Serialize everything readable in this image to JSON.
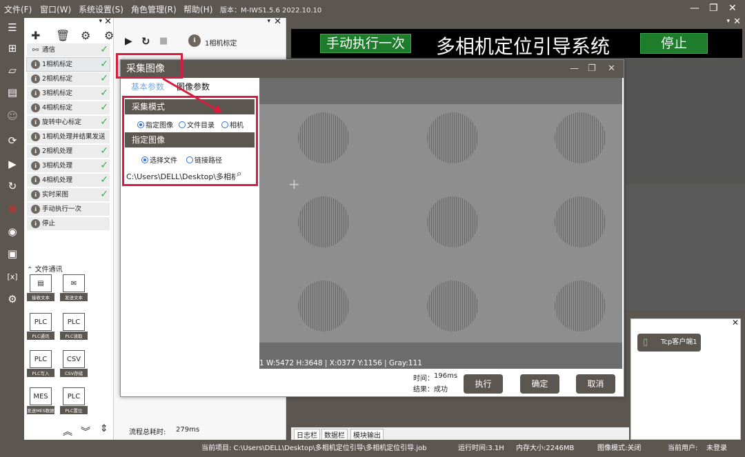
{
  "menu": {
    "file": "文件(F)",
    "window": "窗口(W)",
    "system_settings": "系统设置(S)",
    "role_management": "角色管理(R)",
    "help": "帮助(H)",
    "version": "版本：M-IWS1.5.6 2022.10.10"
  },
  "tree": {
    "items": [
      {
        "label": "通信",
        "checked": true,
        "icon": "network-icon"
      },
      {
        "label": "1相机标定",
        "checked": true,
        "selected": true
      },
      {
        "label": "2相机标定",
        "checked": true
      },
      {
        "label": "3相机标定",
        "checked": true
      },
      {
        "label": "4相机标定",
        "checked": true
      },
      {
        "label": "旋转中心标定",
        "checked": true
      },
      {
        "label": "1相机处理并结果发送",
        "checked": false
      },
      {
        "label": "2相机处理",
        "checked": true
      },
      {
        "label": "3相机处理",
        "checked": true
      },
      {
        "label": "4相机处理",
        "checked": true
      },
      {
        "label": "实时采图",
        "checked": true
      },
      {
        "label": "手动执行一次",
        "checked": false
      },
      {
        "label": "停止",
        "checked": false
      }
    ],
    "file_comm_header": "文件通讯",
    "tools": [
      {
        "label": "接收文本",
        "icon": "printer-icon"
      },
      {
        "label": "发送文本",
        "icon": "envelope-icon"
      },
      {
        "label": "PLC通讯",
        "icon": "plc-icon"
      },
      {
        "label": "PLC读取",
        "icon": "plc-icon"
      },
      {
        "label": "PLC写入",
        "icon": "plc-icon"
      },
      {
        "label": "CSV存储",
        "icon": "csv-icon"
      },
      {
        "label": "发送MES数据",
        "icon": "mes-icon"
      },
      {
        "label": "PLC置位",
        "icon": "plc-icon"
      }
    ]
  },
  "flow": {
    "current_label": "1相机标定",
    "total_time_label": "流程总耗时:",
    "total_time_value": "279ms"
  },
  "header": {
    "manual_run": "手动执行一次",
    "title": "多相机定位引导系统",
    "stop": "停止"
  },
  "dialog": {
    "title": "采集图像",
    "tab_basic": "基本参数",
    "tab_image": "图像参数",
    "capture_mode_header": "采集模式",
    "mode_options": [
      "指定图像",
      "文件目录",
      "相机"
    ],
    "specified_image_header": "指定图像",
    "source_options": [
      "选择文件",
      "链接路径"
    ],
    "path_value": "C:\\Users\\DELL\\Desktop\\多相机",
    "image_status": "1 W:5472 H:3648 | X:0377 Y:1156 | Gray:111",
    "time_label": "时间：",
    "time_value": "196ms",
    "result_label": "结果：",
    "result_value": "成功",
    "execute": "执行",
    "confirm": "确定",
    "cancel": "取消"
  },
  "tcp": {
    "label": "Tcp客户端1"
  },
  "bottom_tabs": [
    "日志栏",
    "数据栏",
    "模块输出"
  ],
  "statusbar": {
    "project": "当前项目: C:\\Users\\DELL\\Desktop\\多相机定位引导\\多相机定位引导.job",
    "runtime": "运行时间:3.1H",
    "memory": "内存大小:2246MB",
    "image_mode": "图像模式:关闭",
    "user_label": "当前用户:",
    "user_value": "未登录"
  },
  "colors": {
    "accent_red": "#d81b3f",
    "dark_gray": "#5b5650",
    "green": "#1d7d2b",
    "check_green": "#3aa84a"
  }
}
